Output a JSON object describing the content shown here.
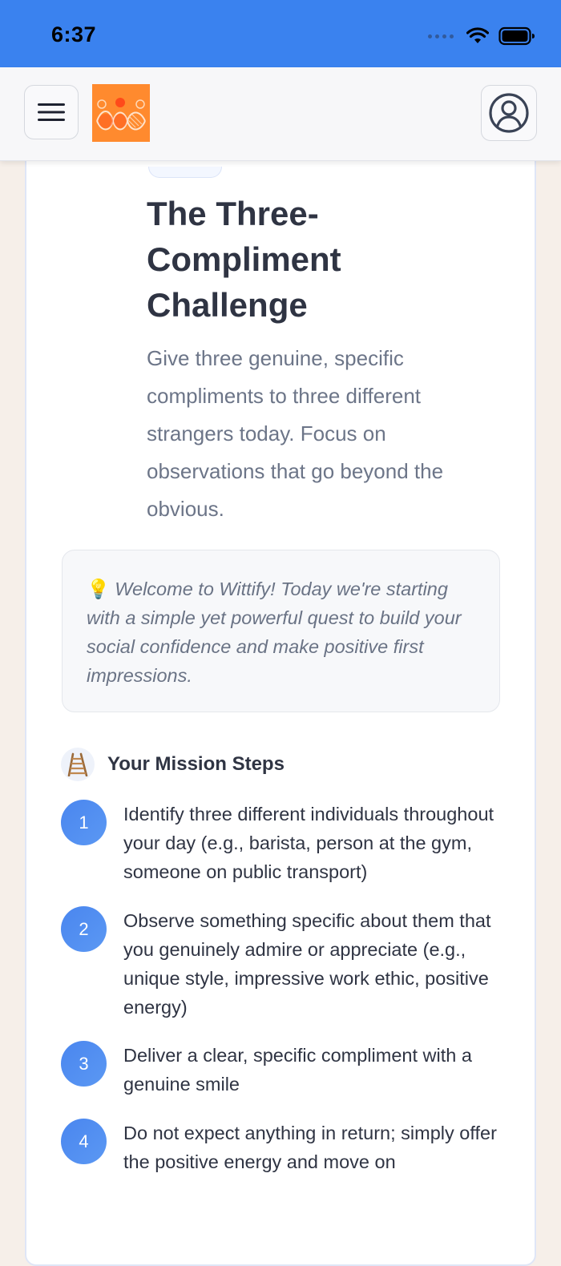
{
  "status_bar": {
    "time": "6:37",
    "background": "#3a82ef",
    "icons": [
      "signal-dots-icon",
      "wifi-icon",
      "battery-icon"
    ]
  },
  "header": {
    "menu_icon": "hamburger-menu-icon",
    "logo": "wittify-logo",
    "profile_icon": "user-profile-icon",
    "logo_color": "#ff8a2e"
  },
  "challenge": {
    "title": "The Three-Compliment Challenge",
    "description": "Give three genuine, specific compliments to three different strangers today. Focus on observations that go beyond the obvious."
  },
  "welcome": {
    "emoji": "💡",
    "text": "Welcome to Wittify! Today we're starting with a simple yet powerful quest to build your social confidence and make positive first impressions."
  },
  "mission": {
    "icon": "ladder-icon",
    "title": "Your Mission Steps",
    "accent": "#4a86ef",
    "steps": [
      {
        "number": "1",
        "text": "Identify three different individuals throughout your day (e.g., barista, person at the gym, someone on public transport)"
      },
      {
        "number": "2",
        "text": "Observe something specific about them that you genuinely admire or appreciate (e.g., unique style, impressive work ethic, positive energy)"
      },
      {
        "number": "3",
        "text": "Deliver a clear, specific compliment with a genuine smile"
      },
      {
        "number": "4",
        "text": "Do not expect anything in return; simply offer the positive energy and move on"
      }
    ]
  }
}
